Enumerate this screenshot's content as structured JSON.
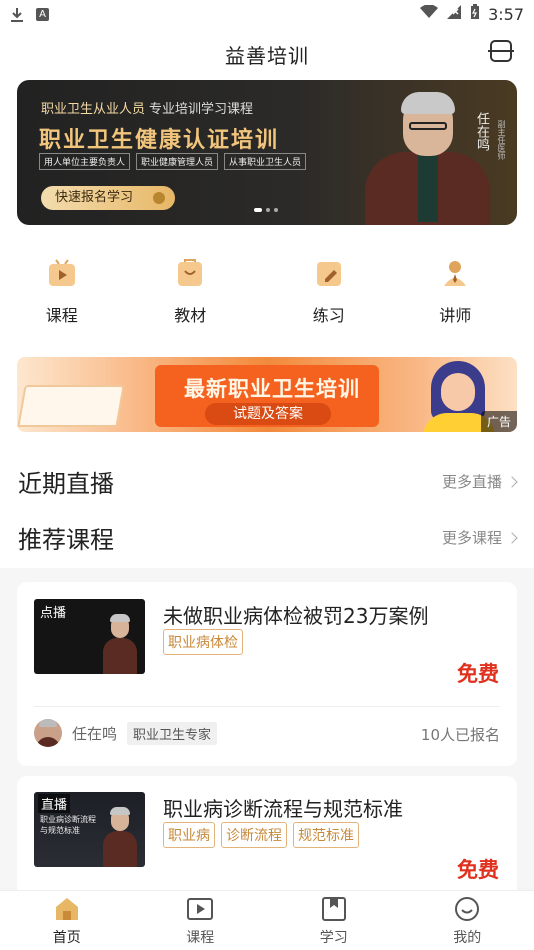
{
  "status_bar": {
    "time": "3:57",
    "a_badge": "A"
  },
  "header": {
    "title": "益善培训",
    "scan_icon": "scan-icon"
  },
  "banner": {
    "subtitle_highlight": "职业卫生从业人员",
    "subtitle_rest": "专业培训学习课程",
    "headline": "职业卫生健康认证培训",
    "tags": [
      "用人单位主要负责人",
      "职业健康管理人员",
      "从事职业卫生人员"
    ],
    "cta": "快速报名学习",
    "instructor_name": "任在鸣",
    "instructor_title": "副主任医师",
    "slides": 3,
    "active_slide": 1
  },
  "quick_nav": [
    {
      "label": "课程",
      "icon": "play-video-icon"
    },
    {
      "label": "教材",
      "icon": "book-bag-icon"
    },
    {
      "label": "练习",
      "icon": "pencil-note-icon"
    },
    {
      "label": "讲师",
      "icon": "teacher-icon"
    }
  ],
  "ad_banner": {
    "title": "最新职业卫生培训",
    "subtitle": "试题及答案",
    "tag": "广告"
  },
  "sections": {
    "live": {
      "title": "近期直播",
      "more": "更多直播"
    },
    "recommended": {
      "title": "推荐课程",
      "more": "更多课程"
    }
  },
  "courses": [
    {
      "kind": "点播",
      "thumb_text": "",
      "title": "未做职业病体检被罚23万案例",
      "tags": [
        "职业病体检"
      ],
      "price": "免费",
      "teacher": "任在鸣",
      "teacher_title": "职业卫生专家",
      "enrolled": "10人已报名"
    },
    {
      "kind": "直播",
      "thumb_text": "职业病诊断流程与规范标准",
      "title": "职业病诊断流程与规范标准",
      "tags": [
        "职业病",
        "诊断流程",
        "规范标准"
      ],
      "price": "免费"
    }
  ],
  "tab_bar": [
    {
      "label": "首页",
      "icon": "home-icon",
      "active": true
    },
    {
      "label": "课程",
      "icon": "course-play-icon",
      "active": false
    },
    {
      "label": "学习",
      "icon": "study-bookmark-icon",
      "active": false
    },
    {
      "label": "我的",
      "icon": "profile-smile-icon",
      "active": false
    }
  ],
  "colors": {
    "accent": "#e8b766",
    "price": "#e0301e",
    "tag_border": "#e3b47a",
    "ad_orange": "#f5621f"
  }
}
